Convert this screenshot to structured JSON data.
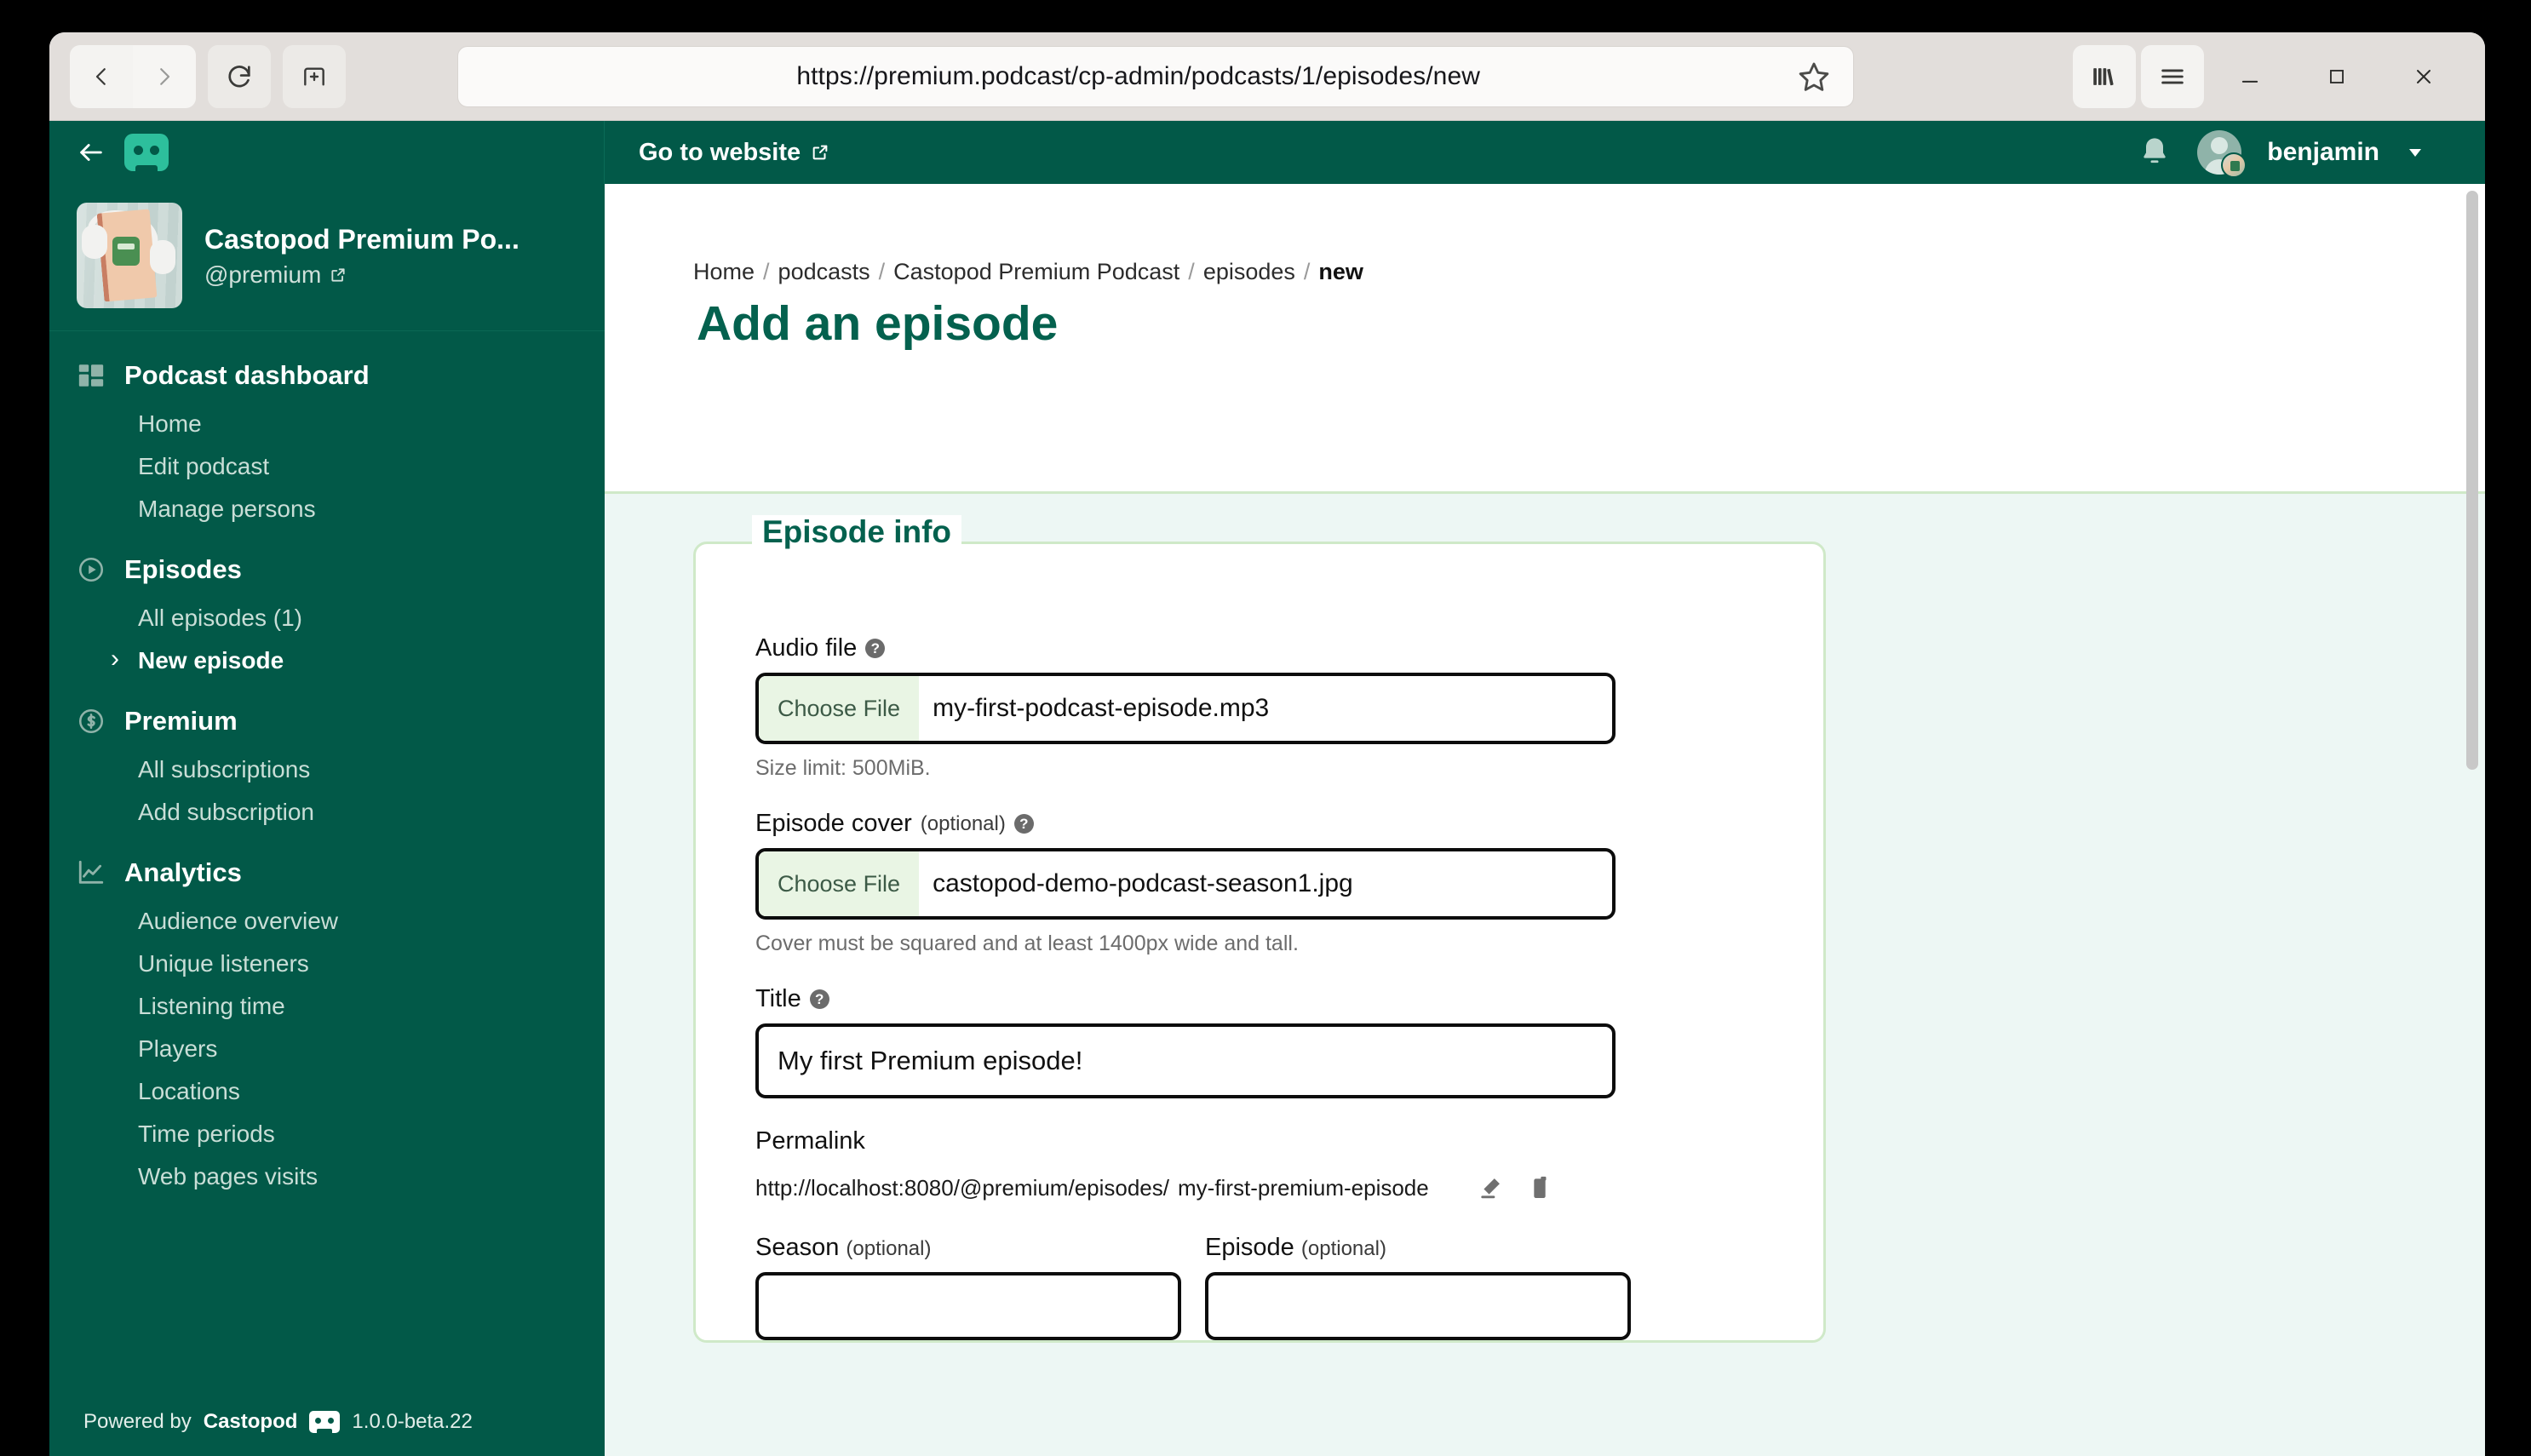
{
  "browser": {
    "url": "https://premium.podcast/cp-admin/podcasts/1/episodes/new",
    "back_label": "Back",
    "forward_label": "Forward",
    "reload_label": "Reload",
    "newtab_label": "New tab",
    "bookmark_label": "Bookmark this page",
    "library_label": "Library",
    "menu_label": "Open application menu",
    "minimize_label": "Minimize",
    "maximize_label": "Maximize",
    "close_label": "Close"
  },
  "app_header": {
    "back_label": "Back",
    "logo_label": "Castopod",
    "go_to_website": "Go to website",
    "notifications_label": "Notifications",
    "username": "benjamin",
    "account_menu_label": "Account menu"
  },
  "sidebar": {
    "podcast": {
      "title": "Castopod Premium Po...",
      "handle": "@premium"
    },
    "sections": [
      {
        "icon": "dashboard-icon",
        "title": "Podcast dashboard",
        "links": [
          {
            "label": "Home",
            "active": false
          },
          {
            "label": "Edit podcast",
            "active": false
          },
          {
            "label": "Manage persons",
            "active": false
          }
        ]
      },
      {
        "icon": "play-circle-icon",
        "title": "Episodes",
        "links": [
          {
            "label": "All episodes (1)",
            "active": false
          },
          {
            "label": "New episode",
            "active": true
          }
        ]
      },
      {
        "icon": "money-circle-icon",
        "title": "Premium",
        "links": [
          {
            "label": "All subscriptions",
            "active": false
          },
          {
            "label": "Add subscription",
            "active": false
          }
        ]
      },
      {
        "icon": "line-chart-icon",
        "title": "Analytics",
        "links": [
          {
            "label": "Audience overview",
            "active": false
          },
          {
            "label": "Unique listeners",
            "active": false
          },
          {
            "label": "Listening time",
            "active": false
          },
          {
            "label": "Players",
            "active": false
          },
          {
            "label": "Locations",
            "active": false
          },
          {
            "label": "Time periods",
            "active": false
          },
          {
            "label": "Web pages visits",
            "active": false
          }
        ]
      }
    ],
    "footer": {
      "powered_by": "Powered by",
      "brand": "Castopod",
      "version": "1.0.0-beta.22"
    }
  },
  "content": {
    "breadcrumb": [
      {
        "label": "Home",
        "current": false
      },
      {
        "label": "podcasts",
        "current": false
      },
      {
        "label": "Castopod Premium Podcast",
        "current": false
      },
      {
        "label": "episodes",
        "current": false
      },
      {
        "label": "new",
        "current": true
      }
    ],
    "breadcrumb_separator": "/",
    "page_title": "Add an episode",
    "form": {
      "legend": "Episode info",
      "audio_file": {
        "label": "Audio file",
        "help": "?",
        "choose_button": "Choose File",
        "value": "my-first-podcast-episode.mp3",
        "hint": "Size limit: 500MiB."
      },
      "episode_cover": {
        "label": "Episode cover",
        "optional": "(optional)",
        "help": "?",
        "choose_button": "Choose File",
        "value": "castopod-demo-podcast-season1.jpg",
        "hint": "Cover must be squared and at least 1400px wide and tall."
      },
      "title": {
        "label": "Title",
        "help": "?",
        "value": "My first Premium episode!"
      },
      "permalink": {
        "label": "Permalink",
        "base": "http://localhost:8080/@premium/episodes/",
        "slug": "my-first-premium-episode",
        "edit_label": "Edit permalink",
        "copy_label": "Copy permalink"
      },
      "season": {
        "label": "Season",
        "optional": "(optional)",
        "value": ""
      },
      "episode": {
        "label": "Episode",
        "optional": "(optional)",
        "value": ""
      }
    }
  },
  "colors": {
    "brand_green": "#025948",
    "accent_green": "#04614e",
    "highlight_green": "#e4f5dd",
    "body_mint": "#edf7f4",
    "logo_teal": "#2dbf9c"
  }
}
